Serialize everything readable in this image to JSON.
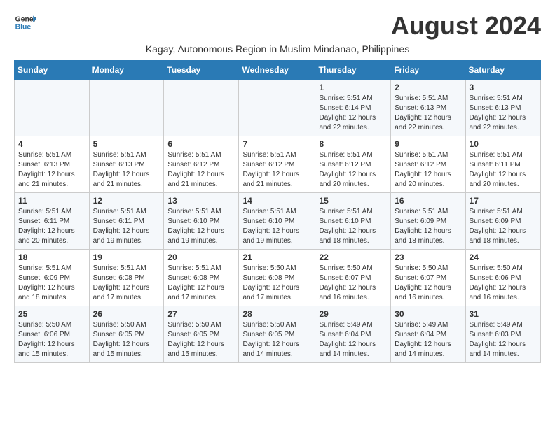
{
  "header": {
    "logo_line1": "General",
    "logo_line2": "Blue",
    "month_title": "August 2024",
    "subtitle": "Kagay, Autonomous Region in Muslim Mindanao, Philippines"
  },
  "weekdays": [
    "Sunday",
    "Monday",
    "Tuesday",
    "Wednesday",
    "Thursday",
    "Friday",
    "Saturday"
  ],
  "weeks": [
    [
      {
        "day": "",
        "info": ""
      },
      {
        "day": "",
        "info": ""
      },
      {
        "day": "",
        "info": ""
      },
      {
        "day": "",
        "info": ""
      },
      {
        "day": "1",
        "info": "Sunrise: 5:51 AM\nSunset: 6:14 PM\nDaylight: 12 hours and 22 minutes."
      },
      {
        "day": "2",
        "info": "Sunrise: 5:51 AM\nSunset: 6:13 PM\nDaylight: 12 hours and 22 minutes."
      },
      {
        "day": "3",
        "info": "Sunrise: 5:51 AM\nSunset: 6:13 PM\nDaylight: 12 hours and 22 minutes."
      }
    ],
    [
      {
        "day": "4",
        "info": "Sunrise: 5:51 AM\nSunset: 6:13 PM\nDaylight: 12 hours and 21 minutes."
      },
      {
        "day": "5",
        "info": "Sunrise: 5:51 AM\nSunset: 6:13 PM\nDaylight: 12 hours and 21 minutes."
      },
      {
        "day": "6",
        "info": "Sunrise: 5:51 AM\nSunset: 6:12 PM\nDaylight: 12 hours and 21 minutes."
      },
      {
        "day": "7",
        "info": "Sunrise: 5:51 AM\nSunset: 6:12 PM\nDaylight: 12 hours and 21 minutes."
      },
      {
        "day": "8",
        "info": "Sunrise: 5:51 AM\nSunset: 6:12 PM\nDaylight: 12 hours and 20 minutes."
      },
      {
        "day": "9",
        "info": "Sunrise: 5:51 AM\nSunset: 6:12 PM\nDaylight: 12 hours and 20 minutes."
      },
      {
        "day": "10",
        "info": "Sunrise: 5:51 AM\nSunset: 6:11 PM\nDaylight: 12 hours and 20 minutes."
      }
    ],
    [
      {
        "day": "11",
        "info": "Sunrise: 5:51 AM\nSunset: 6:11 PM\nDaylight: 12 hours and 20 minutes."
      },
      {
        "day": "12",
        "info": "Sunrise: 5:51 AM\nSunset: 6:11 PM\nDaylight: 12 hours and 19 minutes."
      },
      {
        "day": "13",
        "info": "Sunrise: 5:51 AM\nSunset: 6:10 PM\nDaylight: 12 hours and 19 minutes."
      },
      {
        "day": "14",
        "info": "Sunrise: 5:51 AM\nSunset: 6:10 PM\nDaylight: 12 hours and 19 minutes."
      },
      {
        "day": "15",
        "info": "Sunrise: 5:51 AM\nSunset: 6:10 PM\nDaylight: 12 hours and 18 minutes."
      },
      {
        "day": "16",
        "info": "Sunrise: 5:51 AM\nSunset: 6:09 PM\nDaylight: 12 hours and 18 minutes."
      },
      {
        "day": "17",
        "info": "Sunrise: 5:51 AM\nSunset: 6:09 PM\nDaylight: 12 hours and 18 minutes."
      }
    ],
    [
      {
        "day": "18",
        "info": "Sunrise: 5:51 AM\nSunset: 6:09 PM\nDaylight: 12 hours and 18 minutes."
      },
      {
        "day": "19",
        "info": "Sunrise: 5:51 AM\nSunset: 6:08 PM\nDaylight: 12 hours and 17 minutes."
      },
      {
        "day": "20",
        "info": "Sunrise: 5:51 AM\nSunset: 6:08 PM\nDaylight: 12 hours and 17 minutes."
      },
      {
        "day": "21",
        "info": "Sunrise: 5:50 AM\nSunset: 6:08 PM\nDaylight: 12 hours and 17 minutes."
      },
      {
        "day": "22",
        "info": "Sunrise: 5:50 AM\nSunset: 6:07 PM\nDaylight: 12 hours and 16 minutes."
      },
      {
        "day": "23",
        "info": "Sunrise: 5:50 AM\nSunset: 6:07 PM\nDaylight: 12 hours and 16 minutes."
      },
      {
        "day": "24",
        "info": "Sunrise: 5:50 AM\nSunset: 6:06 PM\nDaylight: 12 hours and 16 minutes."
      }
    ],
    [
      {
        "day": "25",
        "info": "Sunrise: 5:50 AM\nSunset: 6:06 PM\nDaylight: 12 hours and 15 minutes."
      },
      {
        "day": "26",
        "info": "Sunrise: 5:50 AM\nSunset: 6:05 PM\nDaylight: 12 hours and 15 minutes."
      },
      {
        "day": "27",
        "info": "Sunrise: 5:50 AM\nSunset: 6:05 PM\nDaylight: 12 hours and 15 minutes."
      },
      {
        "day": "28",
        "info": "Sunrise: 5:50 AM\nSunset: 6:05 PM\nDaylight: 12 hours and 14 minutes."
      },
      {
        "day": "29",
        "info": "Sunrise: 5:49 AM\nSunset: 6:04 PM\nDaylight: 12 hours and 14 minutes."
      },
      {
        "day": "30",
        "info": "Sunrise: 5:49 AM\nSunset: 6:04 PM\nDaylight: 12 hours and 14 minutes."
      },
      {
        "day": "31",
        "info": "Sunrise: 5:49 AM\nSunset: 6:03 PM\nDaylight: 12 hours and 14 minutes."
      }
    ]
  ]
}
